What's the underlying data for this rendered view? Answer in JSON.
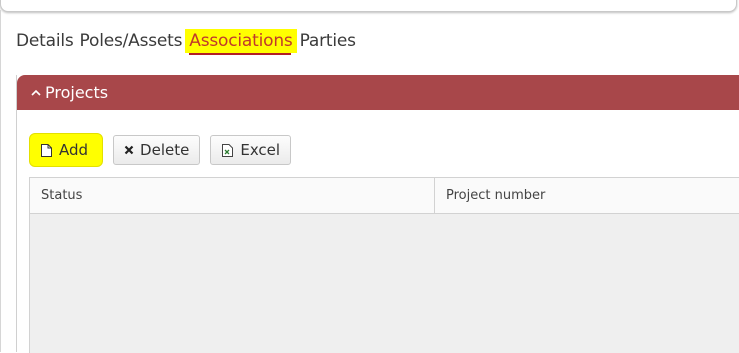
{
  "tabs": [
    {
      "label": "Details"
    },
    {
      "label": "Poles/Assets"
    },
    {
      "label": "Associations"
    },
    {
      "label": "Parties"
    }
  ],
  "active_tab": "Associations",
  "panel": {
    "title": "Projects",
    "header_color": "#a8474a"
  },
  "toolbar": {
    "add_label": "Add",
    "delete_label": "Delete",
    "excel_label": "Excel"
  },
  "grid": {
    "columns": [
      "Status",
      "Project number"
    ],
    "rows": []
  },
  "colors": {
    "highlight": "#ffff00",
    "active_underline": "#b21f24"
  },
  "icons": {
    "collapse": "chevron-up-icon",
    "add": "new-document-icon",
    "delete": "x-icon",
    "excel": "excel-icon"
  }
}
